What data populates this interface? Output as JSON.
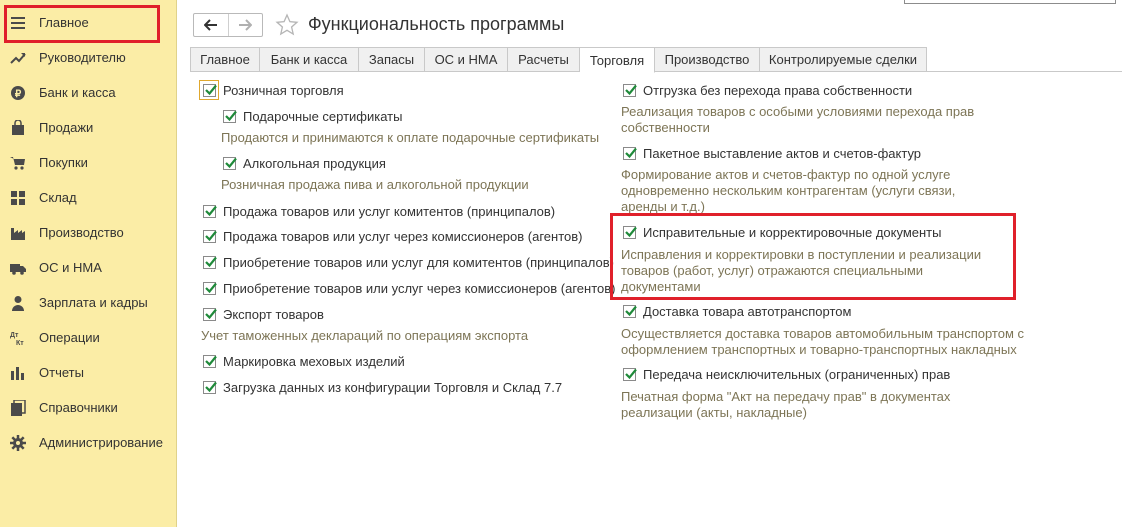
{
  "sidebar": {
    "items": [
      {
        "label": "Главное",
        "icon": "menu-lines-icon"
      },
      {
        "label": "Руководителю",
        "icon": "trend-up-icon"
      },
      {
        "label": "Банк и касса",
        "icon": "ruble-coin-icon"
      },
      {
        "label": "Продажи",
        "icon": "shopping-bag-icon"
      },
      {
        "label": "Покупки",
        "icon": "cart-icon"
      },
      {
        "label": "Склад",
        "icon": "grid-warehouse-icon"
      },
      {
        "label": "Производство",
        "icon": "factory-icon"
      },
      {
        "label": "ОС и НМА",
        "icon": "truck-icon"
      },
      {
        "label": "Зарплата и кадры",
        "icon": "person-icon"
      },
      {
        "label": "Операции",
        "icon": "dt-kt-icon"
      },
      {
        "label": "Отчеты",
        "icon": "bar-chart-icon"
      },
      {
        "label": "Справочники",
        "icon": "books-icon"
      },
      {
        "label": "Администрирование",
        "icon": "gear-icon"
      }
    ]
  },
  "header": {
    "title": "Функциональность программы"
  },
  "tabs": [
    {
      "label": "Главное"
    },
    {
      "label": "Банк и касса"
    },
    {
      "label": "Запасы"
    },
    {
      "label": "ОС и НМА"
    },
    {
      "label": "Расчеты"
    },
    {
      "label": "Торговля"
    },
    {
      "label": "Производство"
    },
    {
      "label": "Контролируемые сделки"
    }
  ],
  "active_tab": "Торговля",
  "left": {
    "retail": {
      "label": "Розничная торговля",
      "checked": true
    },
    "gift": {
      "label": "Подарочные сертификаты",
      "checked": true
    },
    "gift_hint": "Продаются и принимаются к оплате подарочные сертификаты",
    "alcohol": {
      "label": "Алкогольная продукция",
      "checked": true
    },
    "alcohol_hint": "Розничная продажа пива и алкогольной продукции",
    "commit_sale": {
      "label": "Продажа товаров или услуг комитентов (принципалов)",
      "checked": true
    },
    "agent_sale": {
      "label": "Продажа товаров или услуг через комиссионеров (агентов)",
      "checked": true
    },
    "commit_buy": {
      "label": "Приобретение товаров или услуг для комитентов (принципалов)",
      "checked": true
    },
    "agent_buy": {
      "label": "Приобретение товаров или услуг через комиссионеров (агентов)",
      "checked": true
    },
    "export": {
      "label": "Экспорт товаров",
      "checked": true
    },
    "export_hint": "Учет таможенных деклараций по операциям экспорта",
    "fur": {
      "label": "Маркировка меховых изделий",
      "checked": true
    },
    "load77": {
      "label": "Загрузка данных из конфигурации Торговля и Склад 7.7",
      "checked": true
    }
  },
  "right": {
    "ship": {
      "label": "Отгрузка без перехода права собственности",
      "checked": true
    },
    "ship_hint_1": "Реализация товаров с особыми условиями перехода прав",
    "ship_hint_2": "собственности",
    "batch": {
      "label": "Пакетное выставление актов и счетов-фактур",
      "checked": true
    },
    "batch_hint_1": "Формирование актов и счетов-фактур по одной услуге",
    "batch_hint_2": "одновременно нескольким контрагентам (услуги связи,",
    "batch_hint_3": "аренды и т.д.)",
    "corr": {
      "label": "Исправительные и корректировочные документы",
      "checked": true
    },
    "corr_hint_1": "Исправления и корректировки в поступлении и реализации",
    "corr_hint_2": "товаров (работ, услуг) отражаются специальными",
    "corr_hint_3": "документами",
    "auto": {
      "label": "Доставка товара автотранспортом",
      "checked": true
    },
    "auto_hint_1": "Осуществляется доставка товаров автомобильным транспортом с",
    "auto_hint_2": "оформлением транспортных и товарно-транспортных накладных",
    "rights": {
      "label": "Передача неисключительных (ограниченных) прав",
      "checked": true
    },
    "rights_hint_1": "Печатная форма \"Акт на передачу прав\" в документах",
    "rights_hint_2": "реализации (акты, накладные)"
  },
  "colors": {
    "sidebar_bg": "#fbeda6",
    "highlight": "#e0202a",
    "checkmark": "#1f8a3a",
    "hint_text": "#7d7556"
  }
}
